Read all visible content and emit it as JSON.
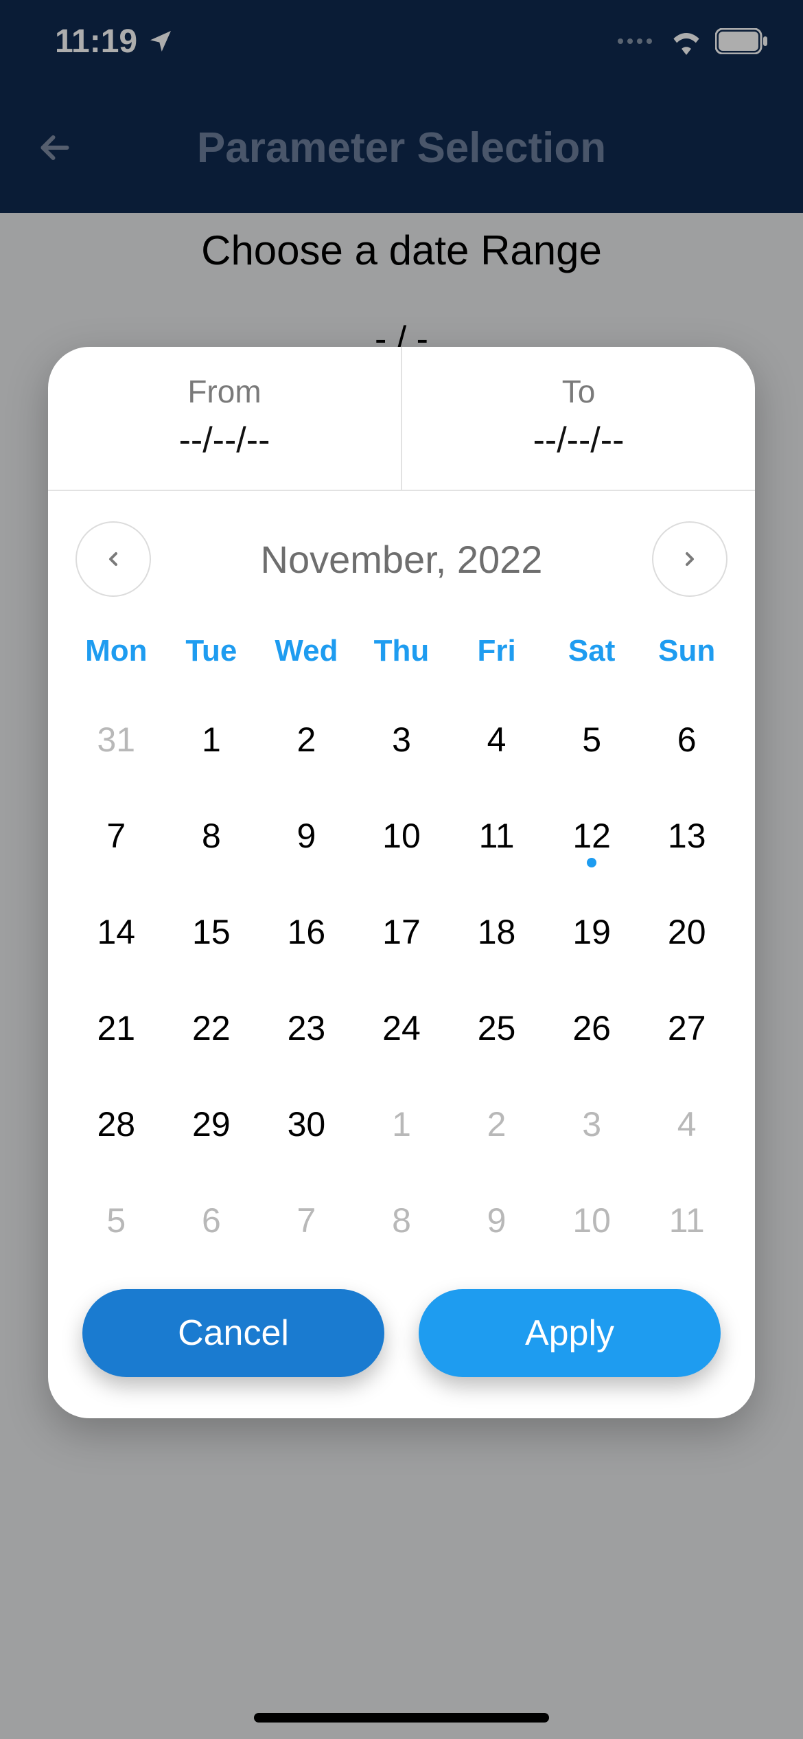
{
  "status": {
    "time": "11:19"
  },
  "nav": {
    "title": "Parameter Selection"
  },
  "behind": {
    "title": "Choose a date Range",
    "sub": "- / -"
  },
  "modal": {
    "from_label": "From",
    "from_value": "--/--/--",
    "to_label": "To",
    "to_value": "--/--/--",
    "month_title": "November, 2022",
    "dow": [
      "Mon",
      "Tue",
      "Wed",
      "Thu",
      "Fri",
      "Sat",
      "Sun"
    ],
    "days": [
      {
        "n": "31",
        "muted": true
      },
      {
        "n": "1"
      },
      {
        "n": "2"
      },
      {
        "n": "3"
      },
      {
        "n": "4"
      },
      {
        "n": "5"
      },
      {
        "n": "6"
      },
      {
        "n": "7"
      },
      {
        "n": "8"
      },
      {
        "n": "9"
      },
      {
        "n": "10"
      },
      {
        "n": "11"
      },
      {
        "n": "12",
        "today": true
      },
      {
        "n": "13"
      },
      {
        "n": "14"
      },
      {
        "n": "15"
      },
      {
        "n": "16"
      },
      {
        "n": "17"
      },
      {
        "n": "18"
      },
      {
        "n": "19"
      },
      {
        "n": "20"
      },
      {
        "n": "21"
      },
      {
        "n": "22"
      },
      {
        "n": "23"
      },
      {
        "n": "24"
      },
      {
        "n": "25"
      },
      {
        "n": "26"
      },
      {
        "n": "27"
      },
      {
        "n": "28"
      },
      {
        "n": "29"
      },
      {
        "n": "30"
      },
      {
        "n": "1",
        "muted": true
      },
      {
        "n": "2",
        "muted": true
      },
      {
        "n": "3",
        "muted": true
      },
      {
        "n": "4",
        "muted": true
      },
      {
        "n": "5",
        "muted": true
      },
      {
        "n": "6",
        "muted": true
      },
      {
        "n": "7",
        "muted": true
      },
      {
        "n": "8",
        "muted": true
      },
      {
        "n": "9",
        "muted": true
      },
      {
        "n": "10",
        "muted": true
      },
      {
        "n": "11",
        "muted": true
      }
    ],
    "cancel_label": "Cancel",
    "apply_label": "Apply"
  }
}
